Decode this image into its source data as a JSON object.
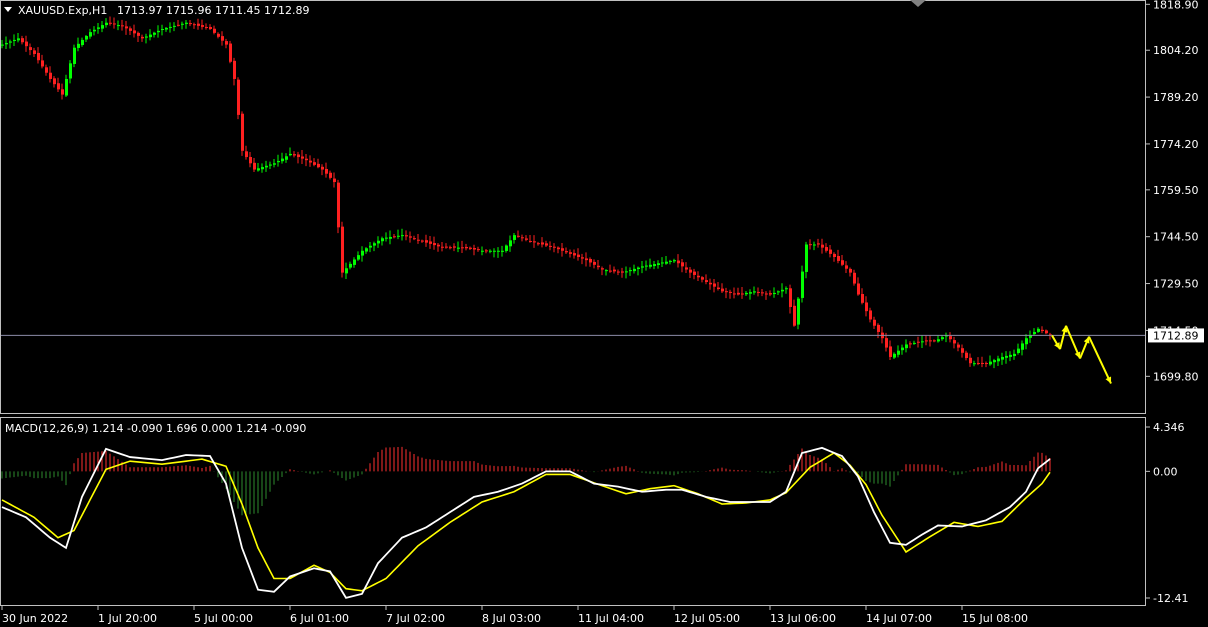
{
  "symbol_header": "XAUUSD.Exp,H1",
  "ohlc": {
    "open": "1713.97",
    "high": "1715.96",
    "low": "1711.45",
    "close": "1712.89"
  },
  "current_price_label": "1712.89",
  "macd_label": "MACD(12,26,9) 1.214 -0.090 1.696 0.000 1.214 -0.090",
  "colors": {
    "background": "#000000",
    "bull_candle": "#00ff00",
    "bear_candle": "#ff2020",
    "hist_positive": "#ff3030",
    "hist_negative": "#2e8b2e",
    "macd_line": "#ffffff",
    "signal_line": "#ffff00",
    "arrows": "#ffff00",
    "price_line": "#8c8ca8",
    "axis": "#c0c0c0"
  },
  "chart_data": [
    {
      "type": "candlestick",
      "title": "XAUUSD.Exp,H1",
      "ylim": [
        1693.5,
        1819.0
      ],
      "price_ticks": [
        "1818.90",
        "1804.20",
        "1789.20",
        "1774.20",
        "1759.50",
        "1744.50",
        "1729.50",
        "1714.50",
        "1699.80"
      ],
      "x_ticks": [
        "30 Jun 2022",
        "1 Jul 20:00",
        "5 Jul 00:00",
        "6 Jul 01:00",
        "7 Jul 02:00",
        "8 Jul 03:00",
        "11 Jul 04:00",
        "12 Jul 05:00",
        "13 Jul 06:00",
        "14 Jul 07:00",
        "15 Jul 08:00"
      ],
      "last_close": 1712.89,
      "close_path": [
        [
          0,
          1806
        ],
        [
          4,
          1808
        ],
        [
          8,
          1803
        ],
        [
          12,
          1795
        ],
        [
          15,
          1790
        ],
        [
          18,
          1805
        ],
        [
          22,
          1810
        ],
        [
          26,
          1813
        ],
        [
          30,
          1812
        ],
        [
          35,
          1808
        ],
        [
          40,
          1811
        ],
        [
          46,
          1813
        ],
        [
          52,
          1811
        ],
        [
          56,
          1806
        ],
        [
          58,
          1795
        ],
        [
          60,
          1772
        ],
        [
          63,
          1766
        ],
        [
          68,
          1768
        ],
        [
          72,
          1771
        ],
        [
          76,
          1769
        ],
        [
          80,
          1766
        ],
        [
          83,
          1762
        ],
        [
          85,
          1733
        ],
        [
          90,
          1740
        ],
        [
          95,
          1744
        ],
        [
          100,
          1745
        ],
        [
          105,
          1743
        ],
        [
          110,
          1741
        ],
        [
          115,
          1741
        ],
        [
          120,
          1740
        ],
        [
          125,
          1740
        ],
        [
          128,
          1745
        ],
        [
          132,
          1743
        ],
        [
          138,
          1741
        ],
        [
          142,
          1739
        ],
        [
          146,
          1737
        ],
        [
          150,
          1734
        ],
        [
          155,
          1733
        ],
        [
          160,
          1735
        ],
        [
          164,
          1736
        ],
        [
          168,
          1737
        ],
        [
          172,
          1733
        ],
        [
          176,
          1730
        ],
        [
          180,
          1727
        ],
        [
          184,
          1726
        ],
        [
          188,
          1727
        ],
        [
          192,
          1726
        ],
        [
          196,
          1728
        ],
        [
          198,
          1716
        ],
        [
          201,
          1742
        ],
        [
          204,
          1742
        ],
        [
          208,
          1738
        ],
        [
          212,
          1733
        ],
        [
          214,
          1726
        ],
        [
          217,
          1718
        ],
        [
          220,
          1712
        ],
        [
          222,
          1706
        ],
        [
          226,
          1710
        ],
        [
          230,
          1711
        ],
        [
          233,
          1711
        ],
        [
          236,
          1713
        ],
        [
          239,
          1709
        ],
        [
          242,
          1704
        ],
        [
          246,
          1704
        ],
        [
          250,
          1706
        ],
        [
          253,
          1707
        ],
        [
          256,
          1712
        ],
        [
          259,
          1715
        ],
        [
          262,
          1712.89
        ]
      ],
      "projection_arrows": [
        [
          1712.89,
          1708.5
        ],
        [
          1708.5,
          1716
        ],
        [
          1716,
          1705.5
        ],
        [
          1705.5,
          1712.5
        ],
        [
          1712.5,
          1697.5
        ]
      ]
    },
    {
      "type": "macd",
      "title": "MACD(12,26,9)",
      "params": [
        12,
        26,
        9
      ],
      "ylim": [
        -12.41,
        4.346
      ],
      "y_ticks": [
        "4.346",
        "0.00",
        "-12.41"
      ],
      "macd_path": [
        [
          0,
          -3.5
        ],
        [
          6,
          -4.5
        ],
        [
          12,
          -6.5
        ],
        [
          16,
          -7.5
        ],
        [
          20,
          -2.5
        ],
        [
          26,
          2.2
        ],
        [
          32,
          1.4
        ],
        [
          40,
          1.1
        ],
        [
          46,
          1.6
        ],
        [
          52,
          1.5
        ],
        [
          56,
          -1.2
        ],
        [
          60,
          -7.5
        ],
        [
          64,
          -11.6
        ],
        [
          68,
          -11.8
        ],
        [
          72,
          -10.3
        ],
        [
          78,
          -9.5
        ],
        [
          82,
          -9.8
        ],
        [
          86,
          -12.4
        ],
        [
          90,
          -12.0
        ],
        [
          94,
          -9.0
        ],
        [
          100,
          -6.5
        ],
        [
          106,
          -5.5
        ],
        [
          112,
          -4.0
        ],
        [
          118,
          -2.5
        ],
        [
          124,
          -2.0
        ],
        [
          130,
          -1.2
        ],
        [
          136,
          0.0
        ],
        [
          142,
          0.0
        ],
        [
          148,
          -1.2
        ],
        [
          154,
          -1.5
        ],
        [
          160,
          -2.0
        ],
        [
          166,
          -1.8
        ],
        [
          170,
          -1.8
        ],
        [
          176,
          -2.5
        ],
        [
          182,
          -3.0
        ],
        [
          188,
          -3.0
        ],
        [
          192,
          -3.0
        ],
        [
          196,
          -2.0
        ],
        [
          200,
          1.8
        ],
        [
          205,
          2.3
        ],
        [
          210,
          1.5
        ],
        [
          214,
          -0.5
        ],
        [
          218,
          -4.0
        ],
        [
          222,
          -7.0
        ],
        [
          226,
          -7.2
        ],
        [
          230,
          -6.2
        ],
        [
          234,
          -5.3
        ],
        [
          240,
          -5.4
        ],
        [
          246,
          -4.8
        ],
        [
          252,
          -3.5
        ],
        [
          256,
          -2.0
        ],
        [
          259,
          0.3
        ],
        [
          262,
          1.214
        ]
      ],
      "signal_path": [
        [
          0,
          -2.8
        ],
        [
          8,
          -4.5
        ],
        [
          14,
          -6.5
        ],
        [
          18,
          -5.8
        ],
        [
          26,
          0.2
        ],
        [
          32,
          1.0
        ],
        [
          40,
          0.7
        ],
        [
          50,
          1.2
        ],
        [
          56,
          0.5
        ],
        [
          60,
          -3.2
        ],
        [
          64,
          -7.5
        ],
        [
          68,
          -10.5
        ],
        [
          72,
          -10.5
        ],
        [
          78,
          -9.2
        ],
        [
          82,
          -9.9
        ],
        [
          86,
          -11.5
        ],
        [
          90,
          -11.7
        ],
        [
          96,
          -10.5
        ],
        [
          104,
          -7.3
        ],
        [
          112,
          -5.0
        ],
        [
          120,
          -3.0
        ],
        [
          128,
          -2.0
        ],
        [
          136,
          -0.3
        ],
        [
          142,
          -0.3
        ],
        [
          150,
          -1.4
        ],
        [
          156,
          -2.2
        ],
        [
          162,
          -1.7
        ],
        [
          168,
          -1.4
        ],
        [
          174,
          -2.2
        ],
        [
          180,
          -3.2
        ],
        [
          186,
          -3.1
        ],
        [
          192,
          -2.8
        ],
        [
          196,
          -2.1
        ],
        [
          202,
          0.4
        ],
        [
          208,
          1.8
        ],
        [
          212,
          0.6
        ],
        [
          216,
          -1.3
        ],
        [
          220,
          -4.3
        ],
        [
          226,
          -7.9
        ],
        [
          232,
          -6.4
        ],
        [
          238,
          -5.0
        ],
        [
          244,
          -5.4
        ],
        [
          250,
          -4.9
        ],
        [
          256,
          -2.6
        ],
        [
          260,
          -1.2
        ],
        [
          262,
          -0.09
        ]
      ],
      "last_values": {
        "macd": 1.214,
        "signal": -0.09
      }
    }
  ]
}
